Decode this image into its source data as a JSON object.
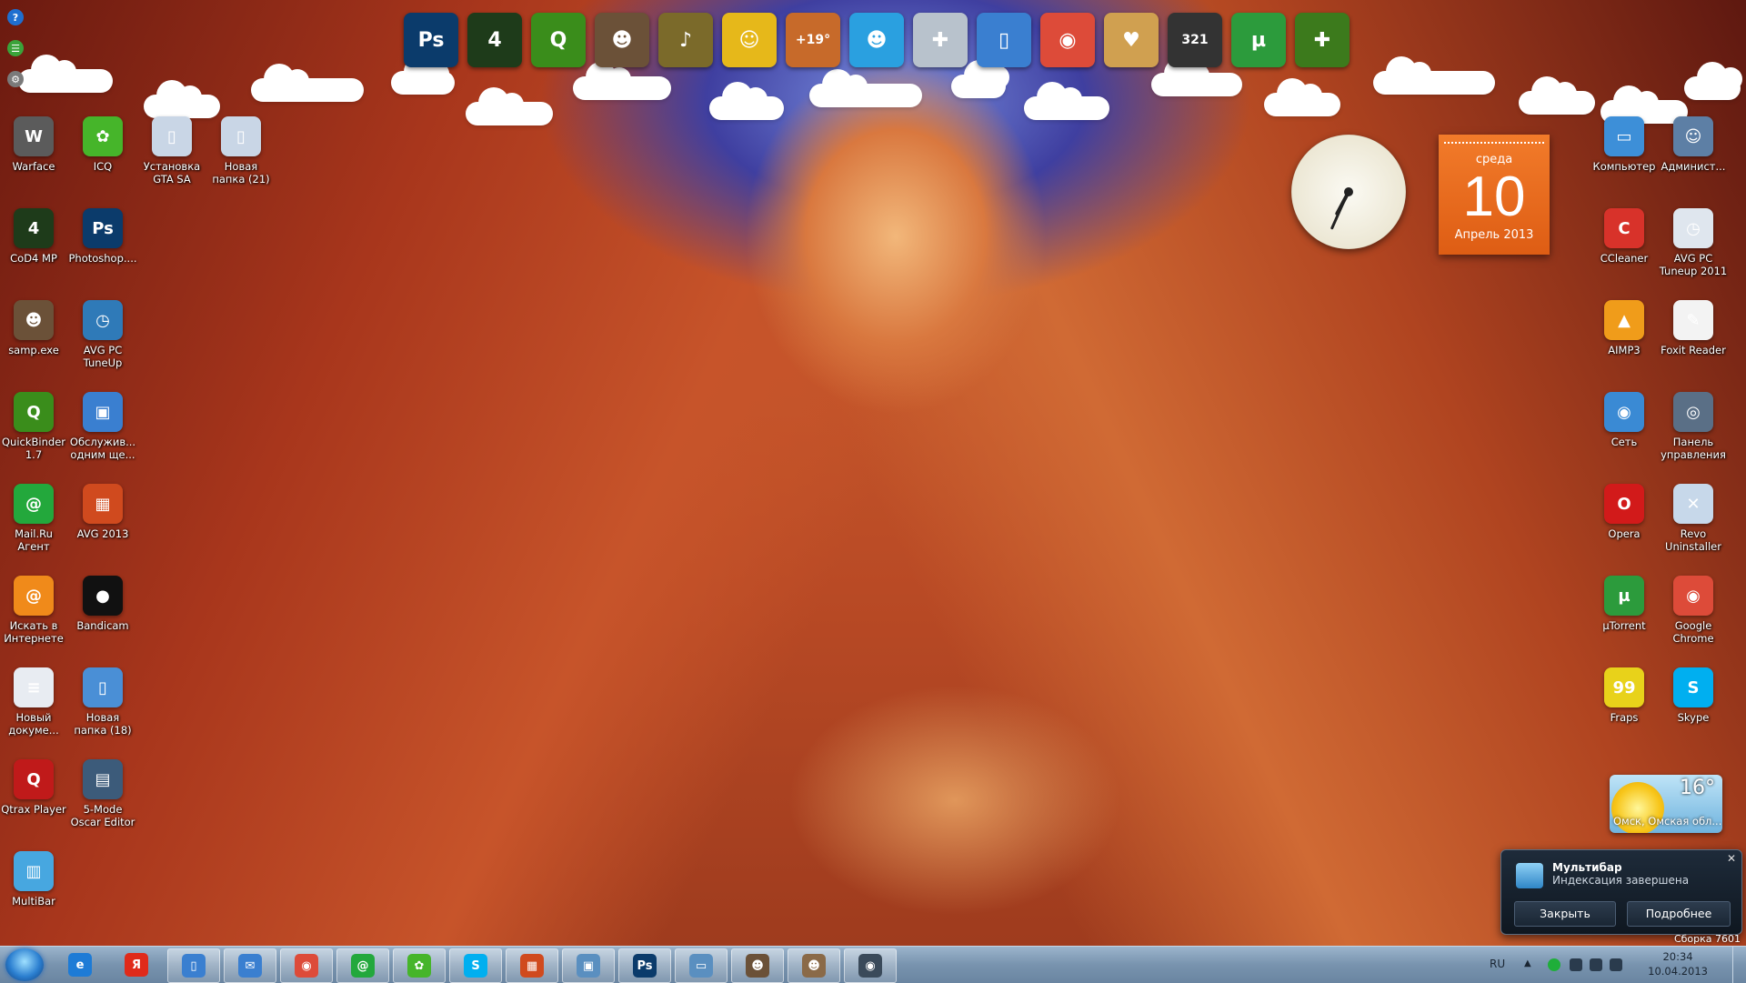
{
  "desktop_left": [
    {
      "label": "Warface",
      "color": "#5b5b5b",
      "glyph": "W",
      "icon": "warface-icon"
    },
    {
      "label": "ICQ",
      "color": "#46b52a",
      "glyph": "✿",
      "icon": "icq-flower-icon"
    },
    {
      "label": "Установка GTA SA",
      "color": "#c9d6e6",
      "glyph": "▯",
      "icon": "folder-icon"
    },
    {
      "label": "Новая папка (21)",
      "color": "#c9d6e6",
      "glyph": "▯",
      "icon": "folder-icon"
    },
    {
      "label": "CoD4 MP",
      "color": "#1e3b1a",
      "glyph": "4",
      "icon": "cod4-icon"
    },
    {
      "label": "Photoshop....",
      "color": "#0b3b6b",
      "glyph": "Ps",
      "icon": "photoshop-icon"
    },
    {
      "label": "samp.exe",
      "color": "#6b5138",
      "glyph": "☻",
      "icon": "samp-icon"
    },
    {
      "label": "AVG PC TuneUp",
      "color": "#2f7ab8",
      "glyph": "◷",
      "icon": "avg-tuneup-icon"
    },
    {
      "label": "QuickBinder 1.7",
      "color": "#3a8d1b",
      "glyph": "Q",
      "icon": "quickbinder-icon"
    },
    {
      "label": "Обслужив... одним щe...",
      "color": "#3a7fd0",
      "glyph": "▣",
      "icon": "maintenance-icon"
    },
    {
      "label": "Mail.Ru Агент",
      "color": "#23a83c",
      "glyph": "@",
      "icon": "mailru-agent-icon"
    },
    {
      "label": "AVG 2013",
      "color": "#d04a1e",
      "glyph": "▦",
      "icon": "avg-icon"
    },
    {
      "label": "Искать в Интернете",
      "color": "#f08a1a",
      "glyph": "@",
      "icon": "search-web-icon"
    },
    {
      "label": "Bandicam",
      "color": "#111111",
      "glyph": "●",
      "icon": "bandicam-icon"
    },
    {
      "label": "Новый докуме...",
      "color": "#e8ecf2",
      "glyph": "≡",
      "icon": "document-icon"
    },
    {
      "label": "Новая папка (18)",
      "color": "#4a8fd6",
      "glyph": "▯",
      "icon": "folder-icon"
    },
    {
      "label": "Qtrax Player",
      "color": "#c01a1a",
      "glyph": "Q",
      "icon": "qtrax-icon"
    },
    {
      "label": "5-Mode Oscar Editor",
      "color": "#3c5b7a",
      "glyph": "▤",
      "icon": "oscar-editor-icon"
    },
    {
      "label": "MultiBar",
      "color": "#47a7e0",
      "glyph": "▥",
      "icon": "multibar-icon"
    }
  ],
  "desktop_right": [
    {
      "label": "Компьютер",
      "color": "#3d8fd8",
      "glyph": "▭",
      "icon": "computer-icon"
    },
    {
      "label": "Админист...",
      "color": "#5d7fa5",
      "glyph": "☺",
      "icon": "admin-user-icon"
    },
    {
      "label": "CCleaner",
      "color": "#d8322a",
      "glyph": "C",
      "icon": "ccleaner-icon"
    },
    {
      "label": "AVG PC Tuneup 2011",
      "color": "#dfe6ee",
      "glyph": "◷",
      "icon": "avg-tuneup-2011-icon"
    },
    {
      "label": "AIMP3",
      "color": "#f09c1a",
      "glyph": "▲",
      "icon": "aimp-icon"
    },
    {
      "label": "Foxit Reader",
      "color": "#f3f3f3",
      "glyph": "✎",
      "icon": "foxit-icon"
    },
    {
      "label": "Сеть",
      "color": "#3a8ad4",
      "glyph": "◉",
      "icon": "network-icon"
    },
    {
      "label": "Панель управления",
      "color": "#5a6f86",
      "glyph": "◎",
      "icon": "control-panel-icon"
    },
    {
      "label": "Opera",
      "color": "#d21a1a",
      "glyph": "O",
      "icon": "opera-icon"
    },
    {
      "label": "Revo Uninstaller",
      "color": "#c7d8ea",
      "glyph": "✕",
      "icon": "revo-icon"
    },
    {
      "label": "µTorrent",
      "color": "#2c9b3c",
      "glyph": "µ",
      "icon": "utorrent-icon"
    },
    {
      "label": "Google Chrome",
      "color": "#dd4b39",
      "glyph": "◉",
      "icon": "chrome-icon"
    },
    {
      "label": "Fraps",
      "color": "#e8d21a",
      "glyph": "99",
      "icon": "fraps-icon"
    },
    {
      "label": "Skype",
      "color": "#00aff0",
      "glyph": "S",
      "icon": "skype-icon"
    }
  ],
  "gadgets_left": [
    "?",
    "☰",
    "⚙"
  ],
  "dock": [
    {
      "glyph": "Ps",
      "color": "#0b3b6b",
      "icon": "photoshop-icon"
    },
    {
      "glyph": "4",
      "color": "#1e3b1a",
      "icon": "cod4-icon"
    },
    {
      "glyph": "Q",
      "color": "#3a8d1b",
      "icon": "quickbinder-icon"
    },
    {
      "glyph": "☻",
      "color": "#6b5138",
      "icon": "samp-icon"
    },
    {
      "glyph": "♪",
      "color": "#7b6a2a",
      "icon": "speaker-icon"
    },
    {
      "glyph": "☺",
      "color": "#e6b81a",
      "icon": "chat-bird-icon"
    },
    {
      "glyph": "+19°",
      "color": "#c76a2a",
      "icon": "weather-icon"
    },
    {
      "glyph": "☻",
      "color": "#2aa0e0",
      "icon": "avatar-icon"
    },
    {
      "glyph": "✚",
      "color": "#b8c2cc",
      "icon": "gamepad-icon"
    },
    {
      "glyph": "▯",
      "color": "#3a7fd0",
      "icon": "folder-icon"
    },
    {
      "glyph": "◉",
      "color": "#dd4b39",
      "icon": "chrome-icon"
    },
    {
      "glyph": "♥",
      "color": "#d0a050",
      "icon": "photos-icon"
    },
    {
      "glyph": "321",
      "color": "#333333",
      "icon": "media-player-icon"
    },
    {
      "glyph": "µ",
      "color": "#2c9b3c",
      "icon": "utorrent-icon"
    },
    {
      "glyph": "✚",
      "color": "#3c7a1c",
      "icon": "add-icon"
    }
  ],
  "calendar": {
    "weekday": "среда",
    "day": "10",
    "month": "Апрель 2013"
  },
  "weather": {
    "temp": "16°",
    "location": "Омск, Омская обл..."
  },
  "toast": {
    "title": "Мультибар",
    "message": "Индексация завершена",
    "close_label": "Закрыть",
    "details_label": "Подробнее"
  },
  "build": "Сборка 7601",
  "taskbar": {
    "items": [
      {
        "glyph": "e",
        "color": "#1d7bd6",
        "icon": "ie-icon"
      },
      {
        "glyph": "Я",
        "color": "#e02a1a",
        "icon": "yandex-icon"
      },
      {
        "glyph": "▯",
        "color": "#3a7fd0",
        "icon": "folder-icon"
      },
      {
        "glyph": "✉",
        "color": "#3a7fd0",
        "icon": "mail-icon"
      },
      {
        "glyph": "◉",
        "color": "#dd4b39",
        "icon": "chrome-icon"
      },
      {
        "glyph": "@",
        "color": "#23a83c",
        "icon": "mailru-agent-icon"
      },
      {
        "glyph": "✿",
        "color": "#46b52a",
        "icon": "icq-flower-icon"
      },
      {
        "glyph": "S",
        "color": "#00aff0",
        "icon": "skype-icon"
      },
      {
        "glyph": "▦",
        "color": "#d04a1e",
        "icon": "avg-icon"
      },
      {
        "glyph": "▣",
        "color": "#5a8fc0",
        "icon": "window-icon"
      },
      {
        "glyph": "Ps",
        "color": "#0b3b6b",
        "icon": "photoshop-icon"
      },
      {
        "glyph": "▭",
        "color": "#5a8fc0",
        "icon": "image-viewer-icon"
      },
      {
        "glyph": "☻",
        "color": "#6b5138",
        "icon": "samp-icon"
      },
      {
        "glyph": "☻",
        "color": "#8a6a48",
        "icon": "gta-icon"
      },
      {
        "glyph": "◉",
        "color": "#3a4a5a",
        "icon": "webcam-icon"
      }
    ],
    "lang": "RU",
    "time": "20:34",
    "date": "10.04.2013"
  }
}
